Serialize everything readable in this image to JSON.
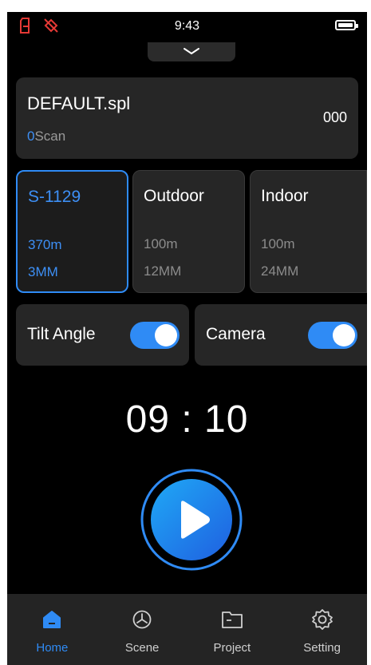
{
  "status_bar": {
    "time": "9:43",
    "icons": [
      "sd-card-icon",
      "no-location-icon",
      "battery-icon"
    ],
    "alert_color": "#e53935"
  },
  "file": {
    "name": "DEFAULT.spl",
    "scan_count": "0",
    "scan_label": "Scan",
    "count": "000"
  },
  "modes": [
    {
      "name": "S-1129",
      "range": "370m",
      "lens": "3MM",
      "selected": true
    },
    {
      "name": "Outdoor",
      "range": "100m",
      "lens": "12MM",
      "selected": false
    },
    {
      "name": "Indoor",
      "range": "100m",
      "lens": "24MM",
      "selected": false
    }
  ],
  "toggles": {
    "tilt": {
      "label": "Tilt Angle",
      "on": true
    },
    "camera": {
      "label": "Camera",
      "on": true
    }
  },
  "timer": "09 : 10",
  "tabs": [
    {
      "label": "Home",
      "icon": "home-icon",
      "active": true
    },
    {
      "label": "Scene",
      "icon": "scene-icon",
      "active": false
    },
    {
      "label": "Project",
      "icon": "folder-icon",
      "active": false
    },
    {
      "label": "Setting",
      "icon": "gear-icon",
      "active": false
    }
  ],
  "colors": {
    "accent": "#2f8bf5",
    "background": "#000000",
    "card": "#262626"
  }
}
